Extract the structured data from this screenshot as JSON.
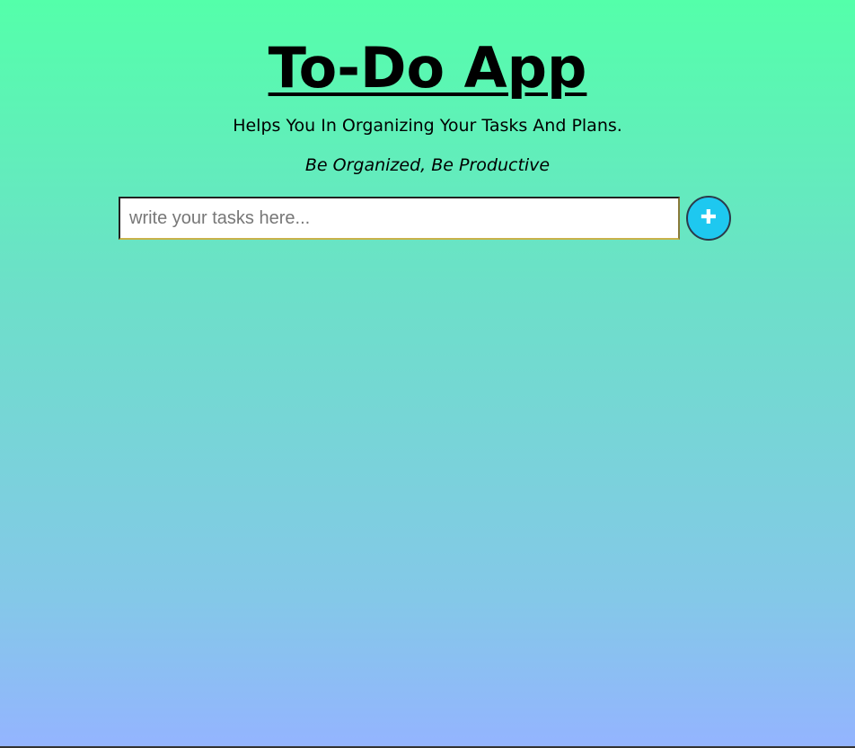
{
  "header": {
    "title": "To-Do App",
    "subtitle": "Helps You In Organizing Your Tasks And Plans.",
    "tagline": "Be Organized, Be Productive"
  },
  "task_form": {
    "input_value": "",
    "input_placeholder": "write your tasks here...",
    "add_button_icon": "plus-icon",
    "add_button_glyph": "✚"
  },
  "colors": {
    "gradient_top": "#54ffaa",
    "gradient_bottom": "#94b4ff",
    "add_button": "#1ec8f0"
  }
}
